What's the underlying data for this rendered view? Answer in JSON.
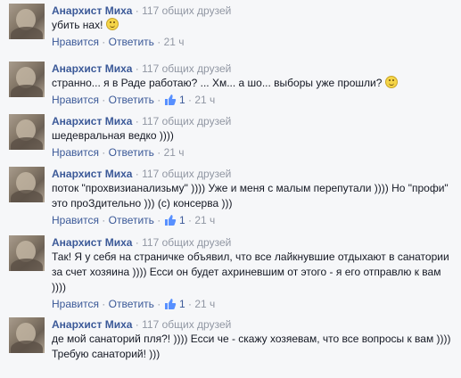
{
  "common": {
    "author": "Анархист Миха",
    "friends": "117 общих друзей",
    "like_label": "Нравится",
    "reply_label": "Ответить",
    "dot": "·"
  },
  "comments": [
    {
      "text": "убить нах!",
      "likes": "",
      "time": "21 ч"
    },
    {
      "text": "странно... я в Раде работаю? ... Хм... а шо... выборы уже прошли?",
      "likes": "1",
      "time": "21 ч"
    },
    {
      "text": "шедевральная ведко ))))",
      "likes": "",
      "time": "21 ч"
    },
    {
      "text": "поток \"прохвизианализьму\" )))) Уже и меня с малым перепутали )))) Но \"профи\" это проЗдительно ))) (с) консерва )))",
      "likes": "1",
      "time": "21 ч"
    },
    {
      "text": "Так! Я у себя на страничке объявил, что все лайкнувшие отдыхают в санатории за счет хозяина )))) Есси он будет ахриневшим от этого - я его отправлю к вам ))))",
      "likes": "1",
      "time": "21 ч"
    },
    {
      "text": "де мой санаторий пля?! )))) Есси че - скажу хозяевам, что все вопросы к вам )))) Требую санаторий! )))",
      "likes": "",
      "time": ""
    }
  ]
}
